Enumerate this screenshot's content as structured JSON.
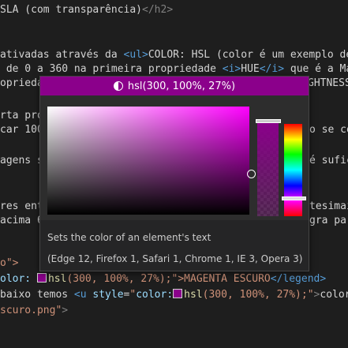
{
  "colors": {
    "editor_bg": "#1e1e1e",
    "magenta_dark": "#8b008b",
    "accent_tag": "#569cd6"
  },
  "code": {
    "l1": {
      "pre": "SLA (com transparência)",
      "close": "</h2>"
    },
    "l2": {
      "pre": "ativadas através da ",
      "ul": "<ul>",
      "rest": "COLOR: HSL (color é um exemplo de"
    },
    "l3": {
      "pre": " de 0 a 360 na primeira propriedade ",
      "i_open": "<i>",
      "hue": "HUE",
      "i_close": "</i>",
      "rest": " que é a Mat"
    },
    "l4": {
      "text": "opriedad",
      "tail": "GHTNESS"
    },
    "l5": {
      "text": "rta pro"
    },
    "l6": {
      "text": "car 100",
      "tail": "o se co"
    },
    "l7": {
      "text": "agens s",
      "tail": "é sufic"
    },
    "l8": {
      "text": "res ent",
      "tail": "tesimai"
    },
    "l9": {
      "text": "acima 6",
      "tail": "gra pa"
    },
    "l10": {
      "text": "o\">"
    },
    "l11": {
      "prop": "olor:",
      "fn": "hsl",
      "args": "(300, 100%, 27%);",
      "rest": "\">MAGENTA ESCURO",
      "close": "</legend>"
    },
    "l12": {
      "pre": "baixo temos ",
      "u_open": "<u",
      "attr": " style",
      "eq": "=",
      "q": "\"",
      "prop": "color:",
      "fn": "hsl",
      "args": "(300, 100%, 27%);",
      "q2": "\"",
      "gt": ">",
      "rest": "color"
    },
    "l13": {
      "str": "scuro.png\"",
      "gt": ">"
    }
  },
  "picker": {
    "title": "hsl(300, 100%, 27%)",
    "description": "Sets the color of an element's text",
    "compat": "(Edge 12, Firefox 1, Safari 1, Chrome 1, IE 3, Opera 3)",
    "hue": 300,
    "saturation": 100,
    "lightness": 27,
    "opacity": 1
  },
  "icons": {
    "header": "contrast-icon",
    "swatch": "color-swatch-icon"
  }
}
